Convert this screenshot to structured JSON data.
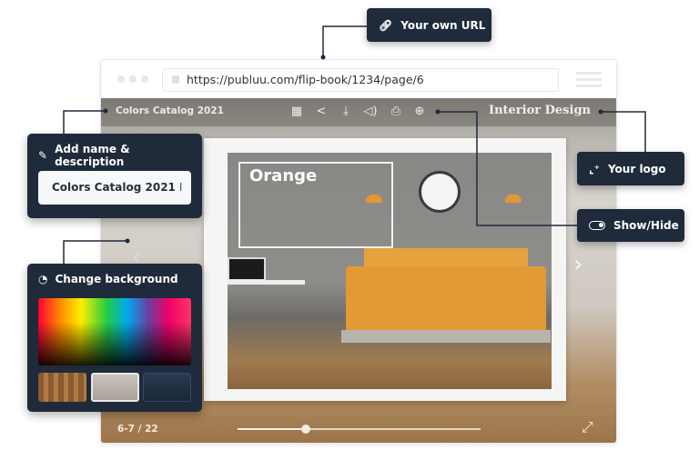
{
  "browser": {
    "url": "https://publuu.com/flip-book/1234/page/6"
  },
  "viewer": {
    "title": "Colors Catalog 2021",
    "brand": "Interior Design",
    "toolbar_icons": [
      "grid-icon",
      "share-icon",
      "download-icon",
      "sound-icon",
      "print-icon",
      "zoom-icon"
    ],
    "page_heading": "Orange",
    "page_count": "6-7 / 22",
    "progress_percent": 28
  },
  "callouts": {
    "url": "Your own URL",
    "logo": "Your logo",
    "show_hide": "Show/Hide",
    "name_panel": {
      "title": "Add name & description",
      "value": "Colors Catalog 2021"
    },
    "background_panel": {
      "title": "Change background",
      "swatches": [
        "wood",
        "concrete",
        "navy"
      ]
    }
  },
  "colors": {
    "panel": "#1f2a3a",
    "accent_lamp": "#e39734"
  }
}
